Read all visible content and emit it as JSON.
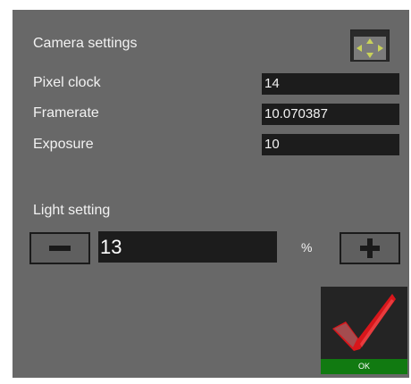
{
  "camera_settings": {
    "title": "Camera settings",
    "adjust_icon": "move-arrows-icon",
    "fields": [
      {
        "label": "Pixel clock",
        "value": "14"
      },
      {
        "label": "Framerate",
        "value": "10.070387"
      },
      {
        "label": "Exposure",
        "value": "10"
      }
    ]
  },
  "light_setting": {
    "title": "Light setting",
    "value": "13",
    "unit": "%",
    "decrement_icon": "minus-icon",
    "increment_icon": "plus-icon"
  },
  "ok_button": {
    "label": "OK",
    "icon": "checkmark-icon"
  },
  "colors": {
    "panel_bg": "#686868",
    "field_bg": "#1c1c1c",
    "icon_accent": "#c9d25a",
    "check_red": "#d8161b",
    "ok_green": "#117a11"
  }
}
